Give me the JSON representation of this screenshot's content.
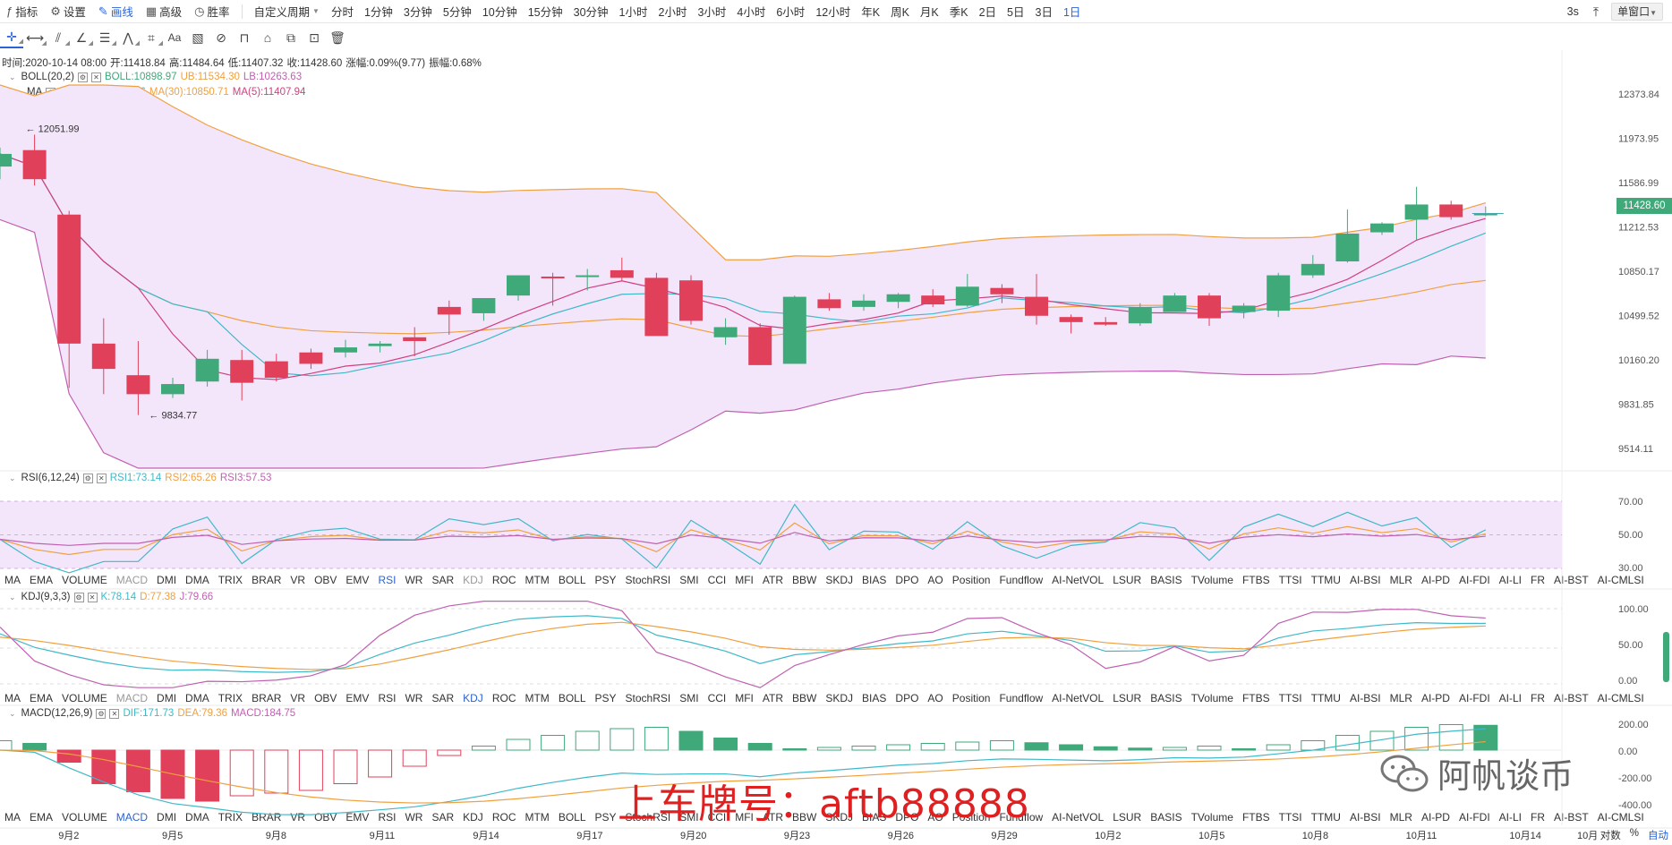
{
  "toolbar": {
    "indicator": "指标",
    "settings": "设置",
    "draw": "画线",
    "advanced": "高级",
    "winrate": "胜率",
    "custom_period": "自定义周期",
    "intervals": [
      "分时",
      "1分钟",
      "3分钟",
      "5分钟",
      "10分钟",
      "15分钟",
      "30分钟",
      "1小时",
      "2小时",
      "3小时",
      "4小时",
      "6小时",
      "12小时",
      "年K",
      "周K",
      "月K",
      "季K",
      "2日",
      "5日",
      "3日",
      "1日"
    ],
    "active_interval": "1日",
    "refresh": "3s",
    "layout": "单窗口"
  },
  "ohlc_info": {
    "time": "时间:2020-10-14 08:00",
    "open": "开:11418.84",
    "high": "高:11484.64",
    "low": "低:11407.32",
    "close": "收:11428.60",
    "change": "涨幅:0.09%(9.77)",
    "amplitude": "振幅:0.68%"
  },
  "legends": {
    "boll_name": "BOLL(20,2)",
    "boll": "BOLL:10898.97",
    "ub": "UB:11534.30",
    "lb": "LB:10263.63",
    "ma_name": "MA",
    "ma7": "MA(7):11287.86",
    "ma30": "MA(30):10850.71",
    "ma5": "MA(5):11407.94",
    "rsi_name": "RSI(6,12,24)",
    "rsi1": "RSI1:73.14",
    "rsi2": "RSI2:65.26",
    "rsi3": "RSI3:57.53",
    "kdj_name": "KDJ(9,3,3)",
    "k": "K:78.14",
    "d": "D:77.38",
    "j": "J:79.66",
    "macd_name": "MACD(12,26,9)",
    "dif": "DIF:171.73",
    "dea": "DEA:79.36",
    "macd": "MACD:184.75"
  },
  "price_axis": [
    "12373.84",
    "11973.95",
    "11586.99",
    "11212.53",
    "10850.17",
    "10499.52",
    "10160.20",
    "9831.85",
    "9514.11"
  ],
  "current_price": "11428.60",
  "high_marker": "12051.99",
  "low_marker": "9834.77",
  "rsi_axis": [
    "70.00",
    "50.00",
    "30.00"
  ],
  "kdj_axis": [
    "100.00",
    "50.00",
    "0.00"
  ],
  "macd_axis": [
    "200.00",
    "0.00",
    "-200.00",
    "-400.00"
  ],
  "indicator_tabs": [
    "MA",
    "EMA",
    "VOLUME",
    "MACD",
    "DMI",
    "DMA",
    "TRIX",
    "BRAR",
    "VR",
    "OBV",
    "EMV",
    "RSI",
    "WR",
    "SAR",
    "KDJ",
    "ROC",
    "MTM",
    "BOLL",
    "PSY",
    "StochRSI",
    "SMI",
    "CCI",
    "MFI",
    "ATR",
    "BBW",
    "SKDJ",
    "BIAS",
    "DPO",
    "AO",
    "Position",
    "Fundflow",
    "AI-NetVOL",
    "LSUR",
    "BASIS",
    "TVolume",
    "FTBS",
    "TTSI",
    "TTMU",
    "AI-BSI",
    "MLR",
    "AI-PD",
    "AI-FDI",
    "AI-LI",
    "FR",
    "AI-BST",
    "AI-CMLSI"
  ],
  "date_axis": [
    "9月2",
    "9月5",
    "9月8",
    "9月11",
    "9月14",
    "9月17",
    "9月20",
    "9月23",
    "9月26",
    "9月29",
    "10月2",
    "10月5",
    "10月8",
    "10月11",
    "10月14",
    "10月"
  ],
  "bottom_right": {
    "log": "对数",
    "pct": "%",
    "auto": "自动"
  },
  "watermark": {
    "plate": "上车牌号：aftb88888",
    "brand": "阿帆谈币"
  },
  "colors": {
    "up": "#3fa97a",
    "down": "#e0405a",
    "band_fill": "#f3e6fb",
    "ub": "#f0a040",
    "lb": "#c060b0",
    "boll_mid": "#f0a040",
    "ma7": "#40b8c8",
    "ma30": "#f0a040",
    "ma5": "#d04080",
    "active": "#2a63d6"
  },
  "chart_data": {
    "type": "candlestick",
    "dates": [
      "9/1",
      "9/2",
      "9/3",
      "9/4",
      "9/5",
      "9/6",
      "9/7",
      "9/8",
      "9/9",
      "9/10",
      "9/11",
      "9/12",
      "9/13",
      "9/14",
      "9/15",
      "9/16",
      "9/17",
      "9/18",
      "9/19",
      "9/20",
      "9/21",
      "9/22",
      "9/23",
      "9/24",
      "9/25",
      "9/26",
      "9/27",
      "9/28",
      "9/29",
      "9/30",
      "10/1",
      "10/2",
      "10/3",
      "10/4",
      "10/5",
      "10/6",
      "10/7",
      "10/8",
      "10/9",
      "10/10",
      "10/11",
      "10/12",
      "10/13",
      "10/14"
    ],
    "ohlc": [
      [
        11800,
        11950,
        11700,
        11900
      ],
      [
        11930,
        12051.99,
        11650,
        11700
      ],
      [
        11420,
        11450,
        10050,
        10400
      ],
      [
        10400,
        10600,
        10000,
        10200
      ],
      [
        10150,
        10420,
        9834.77,
        10000
      ],
      [
        10000,
        10130,
        9970,
        10080
      ],
      [
        10100,
        10350,
        10060,
        10280
      ],
      [
        10270,
        10350,
        9950,
        10090
      ],
      [
        10260,
        10320,
        10100,
        10130
      ],
      [
        10330,
        10360,
        10200,
        10240
      ],
      [
        10330,
        10430,
        10290,
        10370
      ],
      [
        10380,
        10420,
        10330,
        10400
      ],
      [
        10450,
        10530,
        10300,
        10420
      ],
      [
        10690,
        10740,
        10470,
        10630
      ],
      [
        10640,
        10750,
        10580,
        10760
      ],
      [
        10780,
        10900,
        10740,
        10940
      ],
      [
        10930,
        10960,
        10700,
        10920
      ],
      [
        10930,
        10990,
        10820,
        10940
      ],
      [
        10980,
        11080,
        10890,
        10920
      ],
      [
        10920,
        10960,
        10560,
        10460
      ],
      [
        10900,
        10940,
        10550,
        10580
      ],
      [
        10450,
        10600,
        10390,
        10530
      ],
      [
        10530,
        10560,
        10280,
        10230
      ],
      [
        10240,
        10780,
        10260,
        10770
      ],
      [
        10750,
        10800,
        10660,
        10680
      ],
      [
        10690,
        10790,
        10660,
        10740
      ],
      [
        10730,
        10800,
        10680,
        10790
      ],
      [
        10780,
        10830,
        10690,
        10710
      ],
      [
        10700,
        10950,
        10690,
        10850
      ],
      [
        10840,
        10870,
        10720,
        10790
      ],
      [
        10770,
        10950,
        10550,
        10620
      ],
      [
        10610,
        10630,
        10480,
        10570
      ],
      [
        10570,
        10610,
        10540,
        10550
      ],
      [
        10560,
        10720,
        10540,
        10690
      ],
      [
        10650,
        10800,
        10650,
        10780
      ],
      [
        10780,
        10800,
        10540,
        10600
      ],
      [
        10650,
        10720,
        10600,
        10700
      ],
      [
        10660,
        10960,
        10610,
        10940
      ],
      [
        10940,
        11100,
        10920,
        11030
      ],
      [
        11050,
        11460,
        11040,
        11270
      ],
      [
        11280,
        11360,
        11260,
        11350
      ],
      [
        11380,
        11640,
        11220,
        11500
      ],
      [
        11500,
        11530,
        11380,
        11400
      ],
      [
        11418.84,
        11484.64,
        11407.32,
        11428.6
      ]
    ],
    "price_range": [
      9514.11,
      12373.84
    ],
    "macd_hist": [
      70,
      50,
      -90,
      -250,
      -310,
      -360,
      -380,
      -340,
      -320,
      -300,
      -250,
      -200,
      -120,
      -40,
      30,
      80,
      110,
      140,
      160,
      170,
      140,
      90,
      50,
      10,
      20,
      30,
      40,
      50,
      60,
      70,
      55,
      40,
      25,
      15,
      20,
      30,
      10,
      40,
      70,
      110,
      140,
      170,
      190,
      184.75
    ]
  }
}
